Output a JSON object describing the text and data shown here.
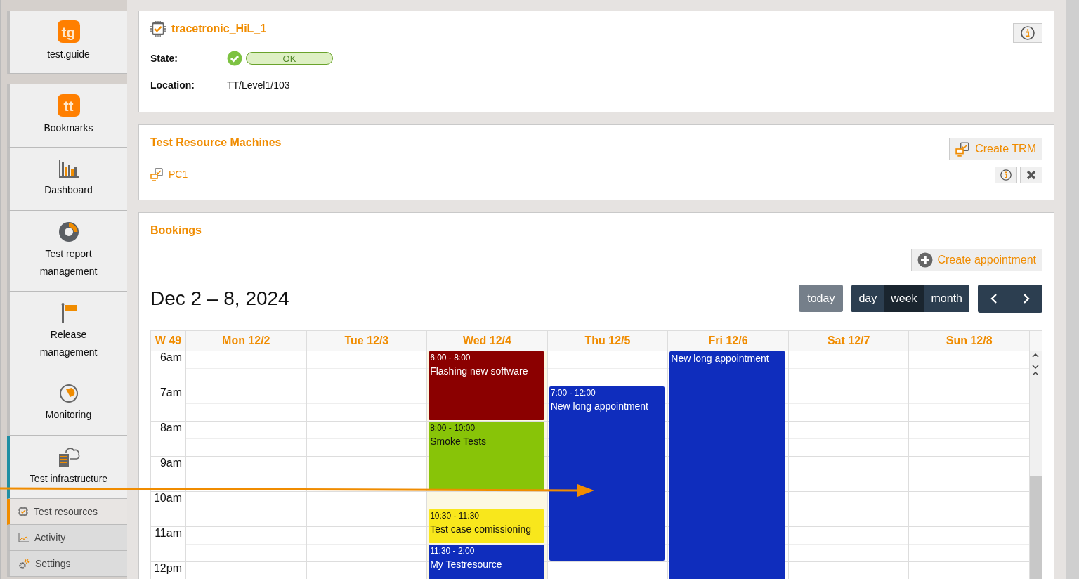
{
  "sidebar": {
    "top": {
      "logo": "tg",
      "label": "test.guide"
    },
    "items": [
      {
        "kind": "logo",
        "logo": "tt",
        "label": "Bookmarks",
        "selected": false
      },
      {
        "kind": "dashboard",
        "label": "Dashboard",
        "selected": false
      },
      {
        "kind": "report",
        "label": "Test report management",
        "selected": false
      },
      {
        "kind": "release",
        "label": "Release management",
        "selected": false
      },
      {
        "kind": "monitoring",
        "label": "Monitoring",
        "selected": false
      },
      {
        "kind": "infrastructure",
        "label": "Test infrastructure",
        "selected": true,
        "children": [
          {
            "kind": "chip",
            "label": "Test resources",
            "selected": true
          },
          {
            "kind": "activity",
            "label": "Activity",
            "selected": false
          },
          {
            "kind": "settings",
            "label": "Settings",
            "selected": false
          }
        ]
      }
    ]
  },
  "resource": {
    "title": "tracetronic_HiL_1",
    "fields": [
      {
        "kind": "state",
        "label": "State:",
        "value": "OK",
        "ok": true
      },
      {
        "kind": "text",
        "label": "Location:",
        "value": "TT/Level1/103"
      }
    ]
  },
  "machines": {
    "title": "Test Resource Machines",
    "create_button": "Create TRM",
    "items": [
      {
        "name": "PC1"
      }
    ]
  },
  "bookings": {
    "title": "Bookings",
    "create_button": "Create appointment",
    "range": "Dec 2 – 8, 2024",
    "today_button": "today",
    "views": [
      {
        "label": "day",
        "selected": false
      },
      {
        "label": "week",
        "selected": true
      },
      {
        "label": "month",
        "selected": false
      }
    ],
    "week": "W 49",
    "days": [
      {
        "label": "Mon 12/2",
        "today": false
      },
      {
        "label": "Tue 12/3",
        "today": false
      },
      {
        "label": "Wed 12/4",
        "today": true,
        "events": [
          {
            "time": "6:00 - 8:00",
            "title": "Flashing new software",
            "color": "#8b0000"
          },
          {
            "time": "8:00 - 10:00",
            "title": "Smoke Tests",
            "color": "#88c408"
          },
          {
            "time": "10:30 - 11:30",
            "title": "Test case comissioning",
            "color": "#f8e71c"
          },
          {
            "time": "11:30 - 2:00",
            "title": "My Testresource",
            "color": "#0f2dbd"
          }
        ]
      },
      {
        "label": "Thu 12/5",
        "today": false,
        "events": [
          {
            "time": "7:00 - 12:00",
            "title": "New long appointment",
            "color": "#0f2dbd"
          }
        ]
      },
      {
        "label": "Fri 12/6",
        "today": false,
        "events": [
          {
            "title": "New long appointment",
            "color": "#0f2dbd"
          }
        ]
      },
      {
        "label": "Sat 12/7",
        "today": false
      },
      {
        "label": "Sun 12/8",
        "today": false
      }
    ],
    "hours": [
      "6am",
      "7am",
      "8am",
      "9am",
      "10am",
      "11am",
      "12pm"
    ]
  }
}
